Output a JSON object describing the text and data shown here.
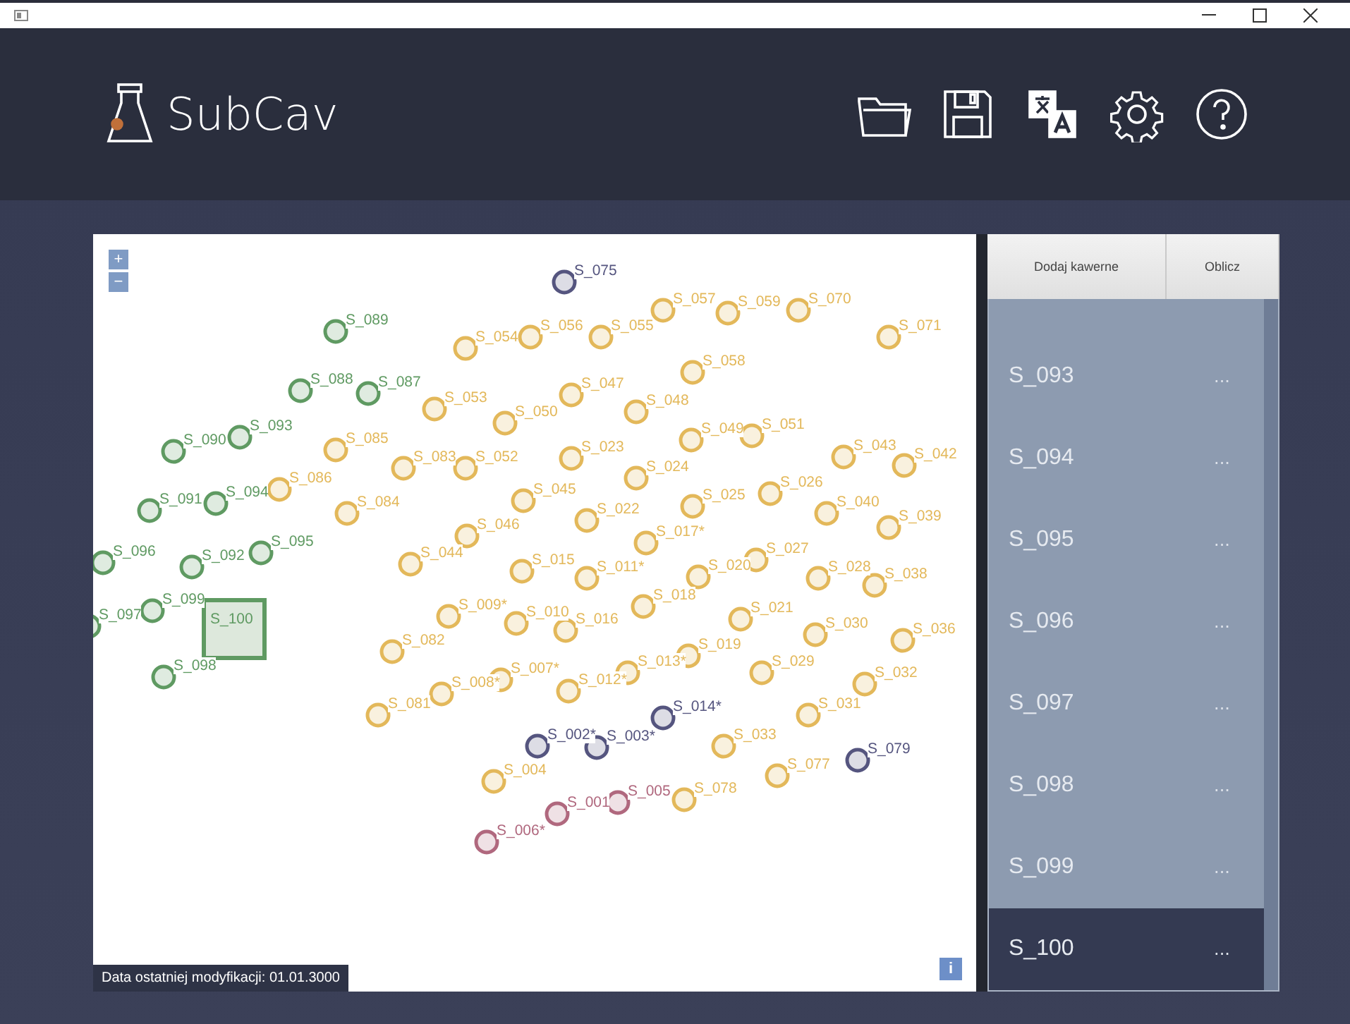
{
  "app": {
    "title": "SubCav"
  },
  "toolbar": {
    "buttons": [
      "Dodaj kawerne",
      "Oblicz"
    ]
  },
  "map": {
    "zoom_in": "+",
    "zoom_out": "−",
    "info": "i",
    "footer": "Data ostatniej modyfikacji: 01.01.3000",
    "nodes": [
      {
        "label": "S_075",
        "color": "#55557f",
        "selected": false
      },
      {
        "label": "S_089",
        "color": "#5f9a62",
        "selected": false
      },
      {
        "label": "S_054",
        "color": "#e3b85a",
        "selected": false
      },
      {
        "label": "S_056",
        "color": "#e3b85a",
        "selected": false
      },
      {
        "label": "S_055",
        "color": "#e3b85a",
        "selected": false
      },
      {
        "label": "S_057",
        "color": "#e3b85a",
        "selected": false
      },
      {
        "label": "S_059",
        "color": "#e3b85a",
        "selected": false
      },
      {
        "label": "S_070",
        "color": "#e3b85a",
        "selected": false
      },
      {
        "label": "S_071",
        "color": "#e3b85a",
        "selected": false
      },
      {
        "label": "S_088",
        "color": "#5f9a62",
        "selected": false
      },
      {
        "label": "S_087",
        "color": "#5f9a62",
        "selected": false
      },
      {
        "label": "S_053",
        "color": "#e3b85a",
        "selected": false
      },
      {
        "label": "S_058",
        "color": "#e3b85a",
        "selected": false
      },
      {
        "label": "S_047",
        "color": "#e3b85a",
        "selected": false
      },
      {
        "label": "S_050",
        "color": "#e3b85a",
        "selected": false
      },
      {
        "label": "S_048",
        "color": "#e3b85a",
        "selected": false
      },
      {
        "label": "S_090",
        "color": "#5f9a62",
        "selected": false
      },
      {
        "label": "S_093",
        "color": "#5f9a62",
        "selected": false
      },
      {
        "label": "S_085",
        "color": "#e3b85a",
        "selected": false
      },
      {
        "label": "S_049",
        "color": "#e3b85a",
        "selected": false
      },
      {
        "label": "S_051",
        "color": "#e3b85a",
        "selected": false
      },
      {
        "label": "S_083",
        "color": "#e3b85a",
        "selected": false
      },
      {
        "label": "S_052",
        "color": "#e3b85a",
        "selected": false
      },
      {
        "label": "S_023",
        "color": "#e3b85a",
        "selected": false
      },
      {
        "label": "S_043",
        "color": "#e3b85a",
        "selected": false
      },
      {
        "label": "S_042",
        "color": "#e3b85a",
        "selected": false
      },
      {
        "label": "S_024",
        "color": "#e3b85a",
        "selected": false
      },
      {
        "label": "S_091",
        "color": "#5f9a62",
        "selected": false
      },
      {
        "label": "S_094",
        "color": "#5f9a62",
        "selected": false
      },
      {
        "label": "S_086",
        "color": "#e3b85a",
        "selected": false
      },
      {
        "label": "S_045",
        "color": "#e3b85a",
        "selected": false
      },
      {
        "label": "S_025",
        "color": "#e3b85a",
        "selected": false
      },
      {
        "label": "S_026",
        "color": "#e3b85a",
        "selected": false
      },
      {
        "label": "S_084",
        "color": "#e3b85a",
        "selected": false
      },
      {
        "label": "S_040",
        "color": "#e3b85a",
        "selected": false
      },
      {
        "label": "S_022",
        "color": "#e3b85a",
        "selected": false
      },
      {
        "label": "S_039",
        "color": "#e3b85a",
        "selected": false
      },
      {
        "label": "S_046",
        "color": "#e3b85a",
        "selected": false
      },
      {
        "label": "S_017*",
        "color": "#e3b85a",
        "selected": false
      },
      {
        "label": "S_096",
        "color": "#5f9a62",
        "selected": false
      },
      {
        "label": "S_092",
        "color": "#5f9a62",
        "selected": false
      },
      {
        "label": "S_095",
        "color": "#5f9a62",
        "selected": false
      },
      {
        "label": "S_044",
        "color": "#e3b85a",
        "selected": false
      },
      {
        "label": "S_015",
        "color": "#e3b85a",
        "selected": false
      },
      {
        "label": "S_011*",
        "color": "#e3b85a",
        "selected": false
      },
      {
        "label": "S_020",
        "color": "#e3b85a",
        "selected": false
      },
      {
        "label": "S_027",
        "color": "#e3b85a",
        "selected": false
      },
      {
        "label": "S_028",
        "color": "#e3b85a",
        "selected": false
      },
      {
        "label": "S_038",
        "color": "#e3b85a",
        "selected": false
      },
      {
        "label": "S_097",
        "color": "#5f9a62",
        "selected": false
      },
      {
        "label": "S_099",
        "color": "#5f9a62",
        "selected": false
      },
      {
        "label": "S_100",
        "color": "#5f9a62",
        "selected": true
      },
      {
        "label": "S_009*",
        "color": "#e3b85a",
        "selected": false
      },
      {
        "label": "S_010",
        "color": "#e3b85a",
        "selected": false
      },
      {
        "label": "S_016",
        "color": "#e3b85a",
        "selected": false
      },
      {
        "label": "S_018",
        "color": "#e3b85a",
        "selected": false
      },
      {
        "label": "S_021",
        "color": "#e3b85a",
        "selected": false
      },
      {
        "label": "S_030",
        "color": "#e3b85a",
        "selected": false
      },
      {
        "label": "S_036",
        "color": "#e3b85a",
        "selected": false
      },
      {
        "label": "S_082",
        "color": "#e3b85a",
        "selected": false
      },
      {
        "label": "S_019",
        "color": "#e3b85a",
        "selected": false
      },
      {
        "label": "S_098",
        "color": "#5f9a62",
        "selected": false
      },
      {
        "label": "S_013*",
        "color": "#e3b85a",
        "selected": false
      },
      {
        "label": "S_029",
        "color": "#e3b85a",
        "selected": false
      },
      {
        "label": "S_007*",
        "color": "#e3b85a",
        "selected": false
      },
      {
        "label": "S_032",
        "color": "#e3b85a",
        "selected": false
      },
      {
        "label": "S_008*",
        "color": "#e3b85a",
        "selected": false
      },
      {
        "label": "S_012*",
        "color": "#e3b85a",
        "selected": false
      },
      {
        "label": "S_081",
        "color": "#e3b85a",
        "selected": false
      },
      {
        "label": "S_014*",
        "color": "#55557f",
        "selected": false
      },
      {
        "label": "S_031",
        "color": "#e3b85a",
        "selected": false
      },
      {
        "label": "S_002*",
        "color": "#55557f",
        "selected": false
      },
      {
        "label": "S_003*",
        "color": "#55557f",
        "selected": false
      },
      {
        "label": "S_033",
        "color": "#e3b85a",
        "selected": false
      },
      {
        "label": "S_079",
        "color": "#55557f",
        "selected": false
      },
      {
        "label": "S_004",
        "color": "#e3b85a",
        "selected": false
      },
      {
        "label": "S_077",
        "color": "#e3b85a",
        "selected": false
      },
      {
        "label": "S_078",
        "color": "#e3b85a",
        "selected": false
      },
      {
        "label": "S_005",
        "color": "#b0687e",
        "selected": false
      },
      {
        "label": "S_001",
        "color": "#b0687e",
        "selected": false
      },
      {
        "label": "S_006*",
        "color": "#b0687e",
        "selected": false
      }
    ]
  },
  "list": {
    "items": [
      {
        "label": "S_093",
        "more": "...",
        "selected": false
      },
      {
        "label": "S_094",
        "more": "...",
        "selected": false
      },
      {
        "label": "S_095",
        "more": "...",
        "selected": false
      },
      {
        "label": "S_096",
        "more": "...",
        "selected": false
      },
      {
        "label": "S_097",
        "more": "...",
        "selected": false
      },
      {
        "label": "S_098",
        "more": "...",
        "selected": false
      },
      {
        "label": "S_099",
        "more": "...",
        "selected": false
      },
      {
        "label": "S_100",
        "more": "...",
        "selected": true
      }
    ]
  }
}
